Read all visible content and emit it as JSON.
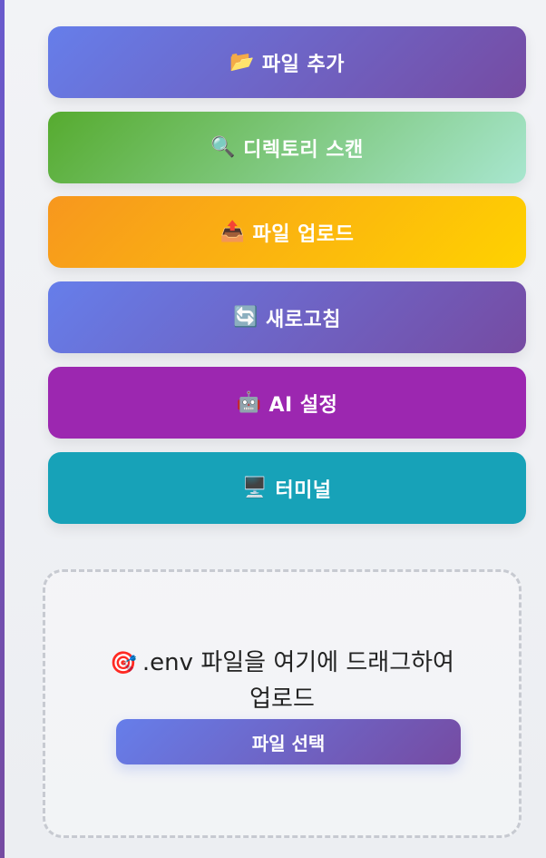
{
  "buttons": [
    {
      "icon": "📂",
      "icon_name": "open-folder-icon",
      "label": "파일 추가"
    },
    {
      "icon": "🔍",
      "icon_name": "magnifier-icon",
      "label": "디렉토리 스캔"
    },
    {
      "icon": "📤",
      "icon_name": "outbox-tray-icon",
      "label": "파일 업로드"
    },
    {
      "icon": "🔄",
      "icon_name": "refresh-icon",
      "label": "새로고침"
    },
    {
      "icon": "🤖",
      "icon_name": "robot-icon",
      "label": "AI 설정"
    },
    {
      "icon": "🖥️",
      "icon_name": "desktop-computer-icon",
      "label": "터미널"
    }
  ],
  "dropzone": {
    "icon": "🎯",
    "icon_name": "target-icon",
    "text": ".env 파일을 여기에 드래그하여 업로드",
    "select_button_label": "파일 선택"
  }
}
